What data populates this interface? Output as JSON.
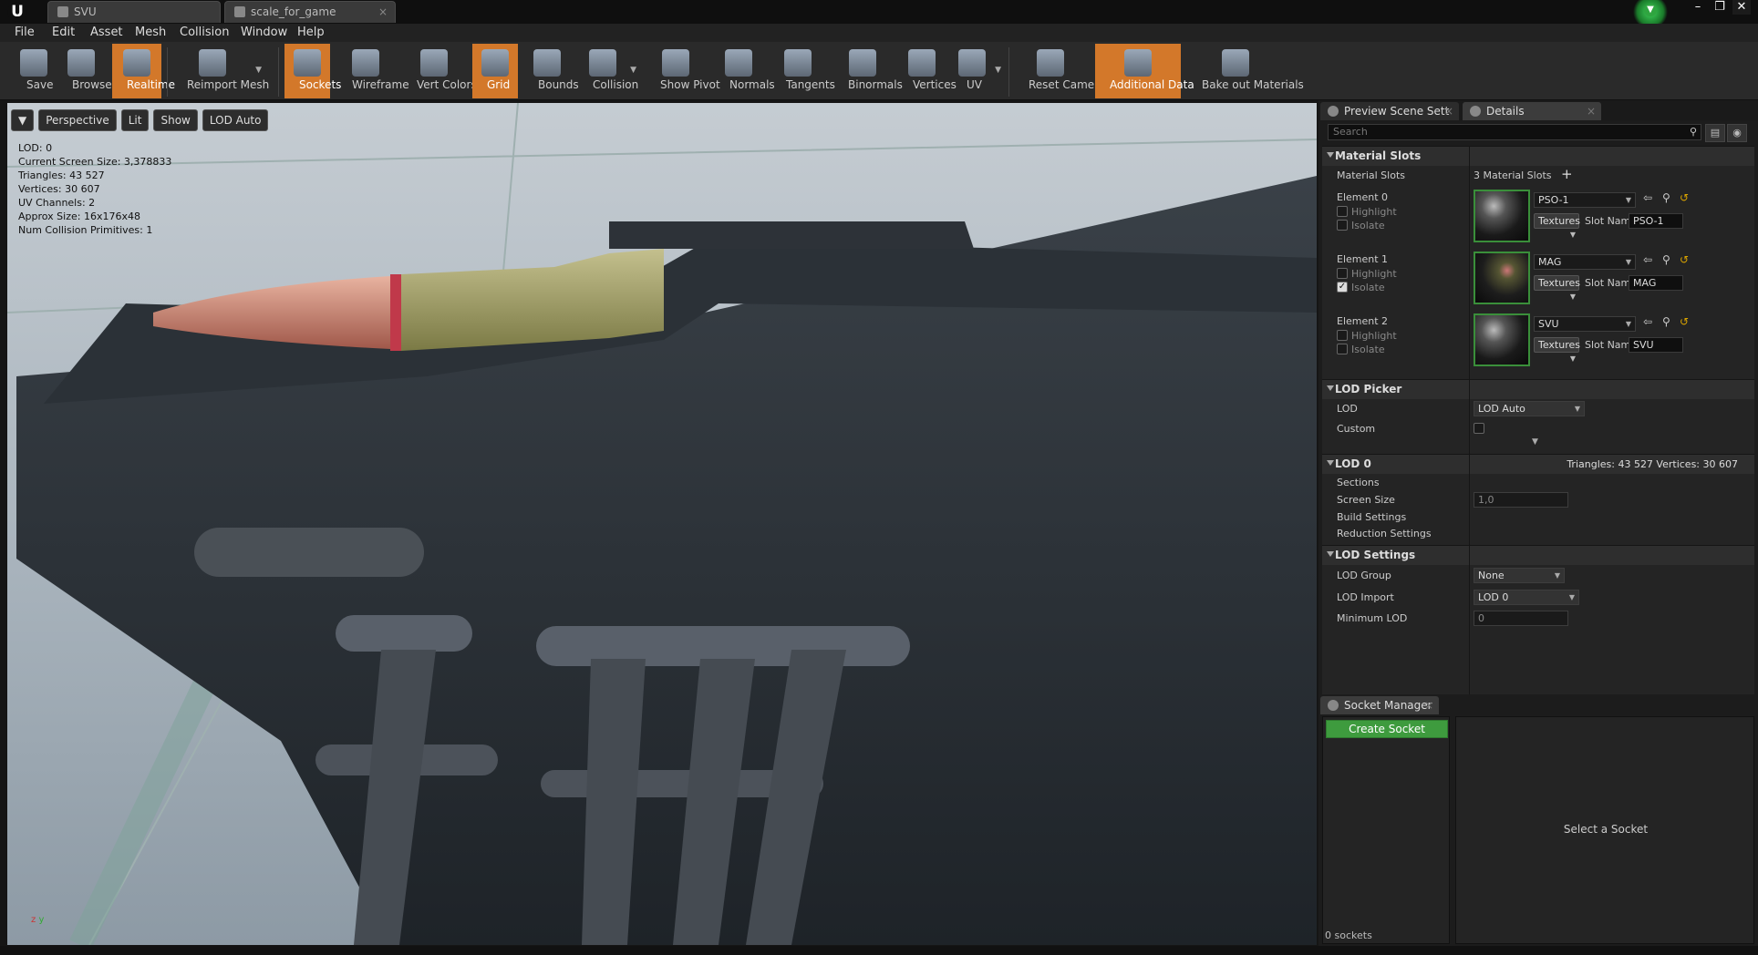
{
  "window": {
    "tabs": [
      {
        "label": "SVU"
      },
      {
        "label": "scale_for_game"
      }
    ]
  },
  "menu": [
    "File",
    "Edit",
    "Asset",
    "Mesh",
    "Collision",
    "Window",
    "Help"
  ],
  "toolbar": {
    "items": [
      {
        "label": "Save",
        "active": false
      },
      {
        "label": "Browse",
        "active": false
      },
      {
        "label": "Realtime",
        "active": true
      },
      {
        "label": "Reimport Mesh",
        "active": false
      },
      {
        "label": "Sockets",
        "active": true
      },
      {
        "label": "Wireframe",
        "active": false
      },
      {
        "label": "Vert Colors",
        "active": false
      },
      {
        "label": "Grid",
        "active": true
      },
      {
        "label": "Bounds",
        "active": false
      },
      {
        "label": "Collision",
        "active": false
      },
      {
        "label": "Show Pivot",
        "active": false
      },
      {
        "label": "Normals",
        "active": false
      },
      {
        "label": "Tangents",
        "active": false
      },
      {
        "label": "Binormals",
        "active": false
      },
      {
        "label": "Vertices",
        "active": false
      },
      {
        "label": "UV",
        "active": false
      },
      {
        "label": "Reset Camera",
        "active": false
      },
      {
        "label": "Additional Data",
        "active": true
      },
      {
        "label": "Bake out Materials",
        "active": false
      }
    ]
  },
  "viewport": {
    "buttons": {
      "perspective": "Perspective",
      "lit": "Lit",
      "show": "Show",
      "lod": "LOD Auto"
    },
    "stats": [
      "LOD:  0",
      "Current Screen Size:  3,378833",
      "Triangles:  43 527",
      "Vertices:  30 607",
      "UV Channels:  2",
      "Approx Size: 16x176x48",
      "Num Collision Primitives:  1"
    ],
    "axis": {
      "z": "z",
      "x": "x",
      "y": "y"
    }
  },
  "panels": {
    "tabs": {
      "preview": "Preview Scene Sett",
      "details": "Details"
    },
    "search_placeholder": "Search"
  },
  "material_slots": {
    "header": "Material Slots",
    "label": "Material Slots",
    "count": "3 Material Slots",
    "elements": [
      {
        "name": "Element 0",
        "material": "PSO-1",
        "slot_name": "PSO-1",
        "highlight": false,
        "isolate": false
      },
      {
        "name": "Element 1",
        "material": "MAG",
        "slot_name": "MAG",
        "highlight": false,
        "isolate": true
      },
      {
        "name": "Element 2",
        "material": "SVU",
        "slot_name": "SVU",
        "highlight": false,
        "isolate": false
      }
    ],
    "highlight_label": "Highlight",
    "isolate_label": "Isolate",
    "textures_label": "Textures",
    "slot_name_label": "Slot Name"
  },
  "lod_picker": {
    "header": "LOD Picker",
    "lod_label": "LOD",
    "lod_value": "LOD Auto",
    "custom_label": "Custom"
  },
  "lod0": {
    "header": "LOD 0",
    "summary": "Triangles: 43 527    Vertices: 30 607",
    "sections": "Sections",
    "screen_size_label": "Screen Size",
    "screen_size_value": "1,0",
    "build_settings": "Build Settings",
    "reduction_settings": "Reduction Settings"
  },
  "lod_settings": {
    "header": "LOD Settings",
    "group_label": "LOD Group",
    "group_value": "None",
    "import_label": "LOD Import",
    "import_value": "LOD 0",
    "min_lod_label": "Minimum LOD",
    "min_lod_value": "0"
  },
  "socket_manager": {
    "tab": "Socket Manager",
    "create": "Create Socket",
    "count": "0 sockets",
    "select": "Select a Socket"
  }
}
